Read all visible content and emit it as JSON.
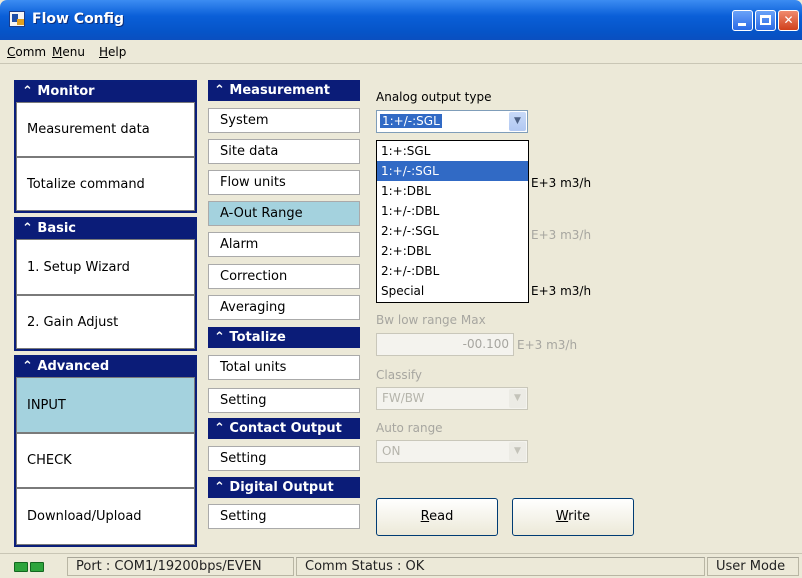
{
  "window": {
    "title": "Flow Config"
  },
  "menu": {
    "comm": "Comm",
    "menu": "Menu",
    "help": "Help"
  },
  "sidebar": {
    "sections": [
      {
        "header": "Monitor",
        "items": [
          "Measurement data",
          "Totalize command"
        ]
      },
      {
        "header": "Basic",
        "items": [
          "1. Setup Wizard",
          "2. Gain Adjust"
        ]
      },
      {
        "header": "Advanced",
        "items": [
          "INPUT",
          "CHECK",
          "Download/Upload"
        ],
        "selected": "INPUT"
      }
    ]
  },
  "middle": {
    "measurement": {
      "header": "Measurement",
      "items": [
        "System",
        "Site data",
        "Flow units",
        "A-Out Range",
        "Alarm",
        "Correction",
        "Averaging"
      ],
      "selected": "A-Out Range"
    },
    "totalize": {
      "header": "Totalize",
      "items": [
        "Total units",
        "Setting"
      ]
    },
    "contact_output": {
      "header": "Contact Output",
      "items": [
        "Setting"
      ]
    },
    "digital_output": {
      "header": "Digital Output",
      "items": [
        "Setting"
      ]
    }
  },
  "form": {
    "analog_output_type": {
      "label": "Analog output type",
      "value": "1:+/-:SGL"
    },
    "dropdown_options": [
      "1:+:SGL",
      "1:+/-:SGL",
      "1:+:DBL",
      "1:+/-:DBL",
      "2:+/-:SGL",
      "2:+:DBL",
      "2:+/-:DBL",
      "Special"
    ],
    "dropdown_selected": "1:+/-:SGL",
    "unit_row1": "E+3 m3/h",
    "unit_row2": "E+3 m3/h",
    "unit_row3": "E+3 m3/h",
    "bw_low_range_max": {
      "label": "Bw low range Max",
      "value": "-00.100",
      "unit": "E+3 m3/h"
    },
    "classify": {
      "label": "Classify",
      "value": "FW/BW"
    },
    "auto_range": {
      "label": "Auto range",
      "value": "ON"
    },
    "read_button": "Read",
    "write_button": "Write"
  },
  "status": {
    "port": "Port : COM1/19200bps/EVEN",
    "comm_status": "Comm Status : OK",
    "mode": "User Mode"
  },
  "colors": {
    "title_bar": "#0a5fd8",
    "section_header": "#0b1c78",
    "selected": "#a4d2de",
    "highlight": "#316ac5"
  },
  "icons": {
    "app": "flow-config-app-icon",
    "section_toggle": "double-chevron-up-icon",
    "combo_arrow": "chevron-down-icon",
    "leds": "green-led-icon"
  }
}
